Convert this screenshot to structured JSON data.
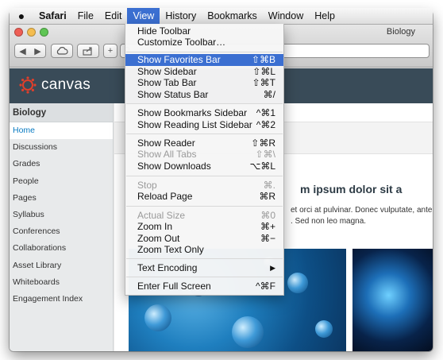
{
  "menubar": {
    "apple_icon": "apple-icon",
    "items": [
      "Safari",
      "File",
      "Edit",
      "View",
      "History",
      "Bookmarks",
      "Window",
      "Help"
    ],
    "active": "View"
  },
  "window": {
    "title": "Biology"
  },
  "canvas": {
    "logo_text": "canvas",
    "brand_color": "#e13f2b"
  },
  "sidebar": {
    "course": "Biology",
    "items": [
      "Home",
      "Discussions",
      "Grades",
      "People",
      "Pages",
      "Syllabus",
      "Conferences",
      "Collaborations",
      "Asset Library",
      "Whiteboards",
      "Engagement Index"
    ],
    "active": "Home"
  },
  "content": {
    "heading_visible": "m ipsum dolor sit a",
    "para_line1_visible": "et orci at pulvinar. Donec vulputate, ante",
    "para_line2_visible": ". Sed non leo magna."
  },
  "view_menu": {
    "items": [
      {
        "label": "Hide Toolbar",
        "shortcut": ""
      },
      {
        "label": "Customize Toolbar…",
        "shortcut": ""
      },
      {
        "label": "Show Favorites Bar",
        "shortcut": "⇧⌘B"
      },
      {
        "label": "Show Sidebar",
        "shortcut": "⇧⌘L"
      },
      {
        "label": "Show Tab Bar",
        "shortcut": "⇧⌘T"
      },
      {
        "label": "Show Status Bar",
        "shortcut": "⌘/"
      },
      {
        "label": "Show Bookmarks Sidebar",
        "shortcut": "^⌘1"
      },
      {
        "label": "Show Reading List Sidebar",
        "shortcut": "^⌘2"
      },
      {
        "label": "Show Reader",
        "shortcut": "⇧⌘R"
      },
      {
        "label": "Show All Tabs",
        "shortcut": "⇧⌘\\"
      },
      {
        "label": "Show Downloads",
        "shortcut": "⌥⌘L"
      },
      {
        "label": "Stop",
        "shortcut": "⌘."
      },
      {
        "label": "Reload Page",
        "shortcut": "⌘R"
      },
      {
        "label": "Actual Size",
        "shortcut": "⌘0"
      },
      {
        "label": "Zoom In",
        "shortcut": "⌘+"
      },
      {
        "label": "Zoom Out",
        "shortcut": "⌘−"
      },
      {
        "label": "Zoom Text Only",
        "shortcut": ""
      },
      {
        "label": "Text Encoding",
        "shortcut": ""
      },
      {
        "label": "Enter Full Screen",
        "shortcut": "^⌘F"
      }
    ],
    "highlighted": "Show Favorites Bar",
    "disabled": [
      "Show All Tabs",
      "Stop",
      "Actual Size"
    ]
  }
}
